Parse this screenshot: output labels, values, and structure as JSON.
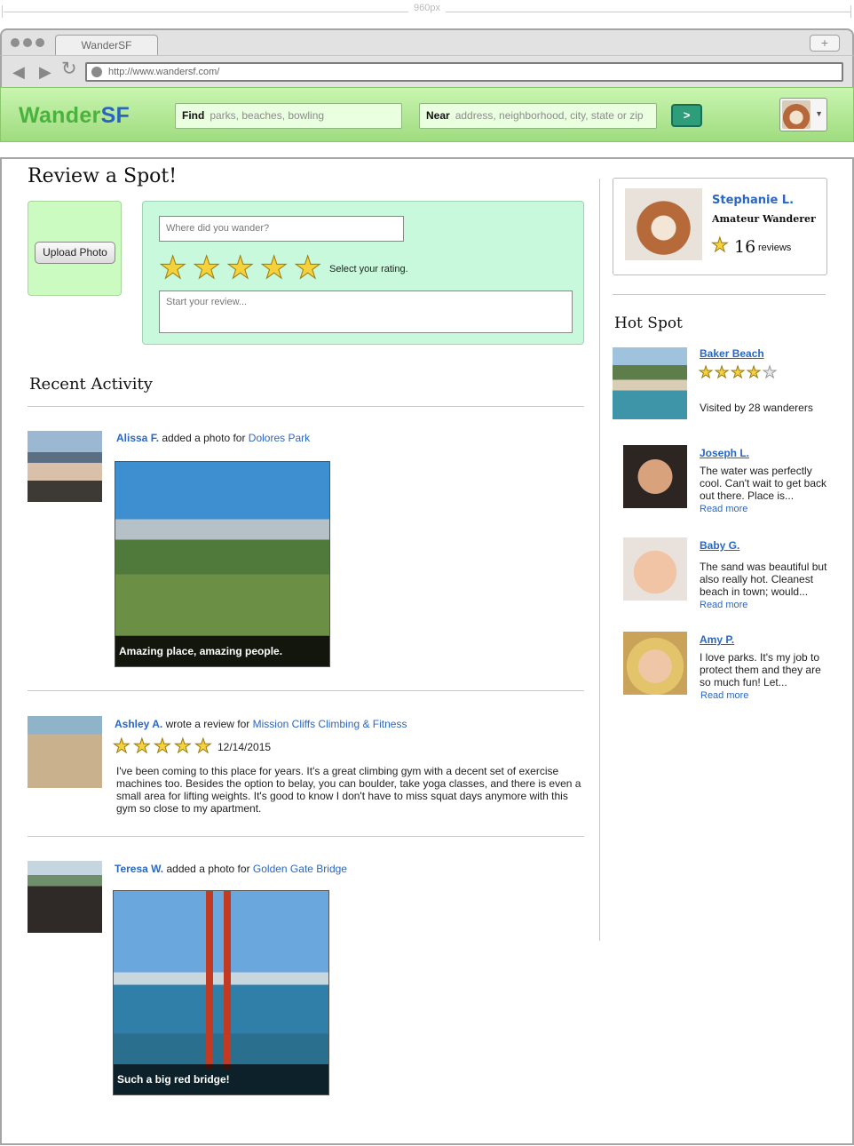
{
  "ruler": {
    "label": "960px"
  },
  "browser": {
    "tab_title": "WanderSF",
    "new_tab": "+",
    "url": "http://www.wandersf.com/"
  },
  "header": {
    "logo_part1": "Wander",
    "logo_part2": "SF",
    "find_label": "Find",
    "find_placeholder": "parks, beaches, bowling",
    "near_label": "Near",
    "near_placeholder": "address, neighborhood, city, state or zip",
    "go_label": ">",
    "colors": {
      "brand_green": "#4bb33d",
      "brand_blue": "#2a64c0",
      "bar": "#b5ea98",
      "go": "#2e9e7a"
    }
  },
  "review_form": {
    "title": "Review a Spot!",
    "upload_label": "Upload Photo",
    "where_placeholder": "Where did you wander?",
    "rating_label": "Select your rating.",
    "rating_stars": 5,
    "review_placeholder": "Start your review..."
  },
  "activity": {
    "title": "Recent Activity",
    "items": [
      {
        "user": "Alissa F.",
        "verb": "added a photo for",
        "place": "Dolores Park",
        "caption": "Amazing place, amazing people."
      },
      {
        "user": "Ashley A.",
        "verb": "wrote a review for",
        "place": "Mission Cliffs Climbing & Fitness",
        "rating": 5,
        "date": "12/14/2015",
        "text": "I've been coming to this place for years. It's a great climbing gym with a decent set of exercise machines too. Besides the option to belay, you can boulder, take yoga classes, and there is even a small area for lifting weights. It's good to know I don't have to miss squat days anymore with this gym so close to my apartment."
      },
      {
        "user": "Teresa W.",
        "verb": "added a photo for",
        "place": "Golden Gate Bridge",
        "caption": "Such a big red bridge!"
      }
    ]
  },
  "profile": {
    "name": "Stephanie L.",
    "rank": "Amateur Wanderer",
    "review_count": "16",
    "review_label": "reviews"
  },
  "hot_spot": {
    "title": "Hot Spot",
    "name": "Baker Beach",
    "rating": 4.5,
    "visits": "Visited by 28 wanderers",
    "reviews": [
      {
        "name": "Joseph L.",
        "text": "The water was perfectly cool. Can't wait to get back out there. Place is...",
        "more": "Read more"
      },
      {
        "name": "Baby G.",
        "text": "The sand was beautiful but also really hot. Cleanest beach in town; would...",
        "more": "Read more"
      },
      {
        "name": "Amy P.",
        "text": "I love parks. It's my job to protect them and they are so much fun! Let...",
        "more": "Read more"
      }
    ]
  }
}
